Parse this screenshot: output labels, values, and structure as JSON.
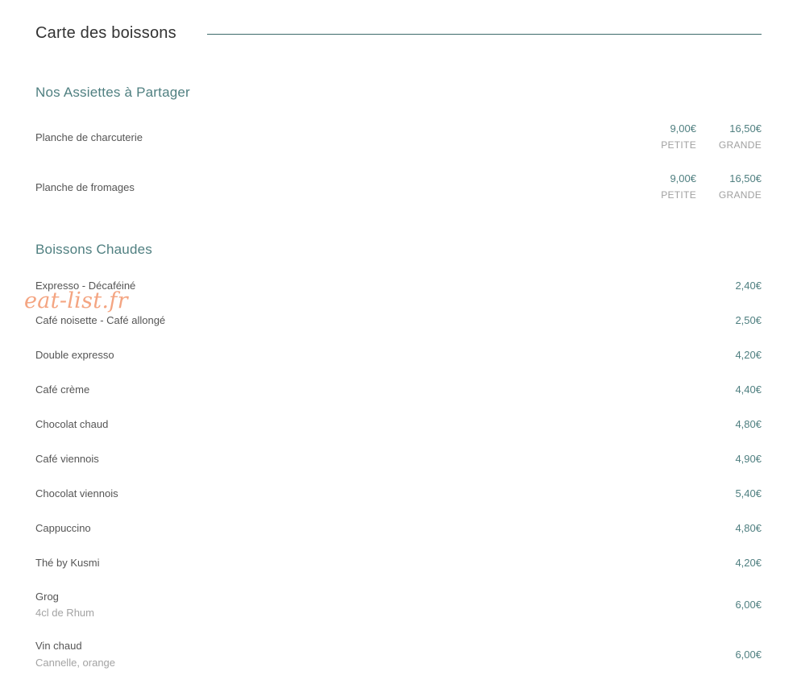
{
  "page": {
    "title": "Carte des boissons",
    "watermark": "eat-list.fr"
  },
  "sections": [
    {
      "title": "Nos Assiettes à Partager",
      "items": [
        {
          "name": "Planche de charcuterie",
          "prices": [
            {
              "amount": "9,00€",
              "size": "PETITE"
            },
            {
              "amount": "16,50€",
              "size": "GRANDE"
            }
          ]
        },
        {
          "name": "Planche de fromages",
          "prices": [
            {
              "amount": "9,00€",
              "size": "PETITE"
            },
            {
              "amount": "16,50€",
              "size": "GRANDE"
            }
          ]
        }
      ]
    },
    {
      "title": "Boissons Chaudes",
      "items": [
        {
          "name": "Expresso - Décaféiné",
          "price": "2,40€"
        },
        {
          "name": "Café noisette - Café allongé",
          "price": "2,50€"
        },
        {
          "name": "Double expresso",
          "price": "4,20€"
        },
        {
          "name": "Café crème",
          "price": "4,40€"
        },
        {
          "name": "Chocolat chaud",
          "price": "4,80€"
        },
        {
          "name": "Café viennois",
          "price": "4,90€"
        },
        {
          "name": "Chocolat viennois",
          "price": "5,40€"
        },
        {
          "name": "Cappuccino",
          "price": "4,80€"
        },
        {
          "name": "Thé by Kusmi",
          "price": "4,20€"
        },
        {
          "name": "Grog",
          "description": "4cl de Rhum",
          "price": "6,00€"
        },
        {
          "name": "Vin chaud",
          "description": "Cannelle, orange",
          "price": "6,00€"
        }
      ]
    }
  ],
  "colors": {
    "accent": "#4f7f80",
    "rule": "#3e6a6a",
    "text": "#555555",
    "muted": "#a3a3a3",
    "watermark": "#f4a582"
  }
}
